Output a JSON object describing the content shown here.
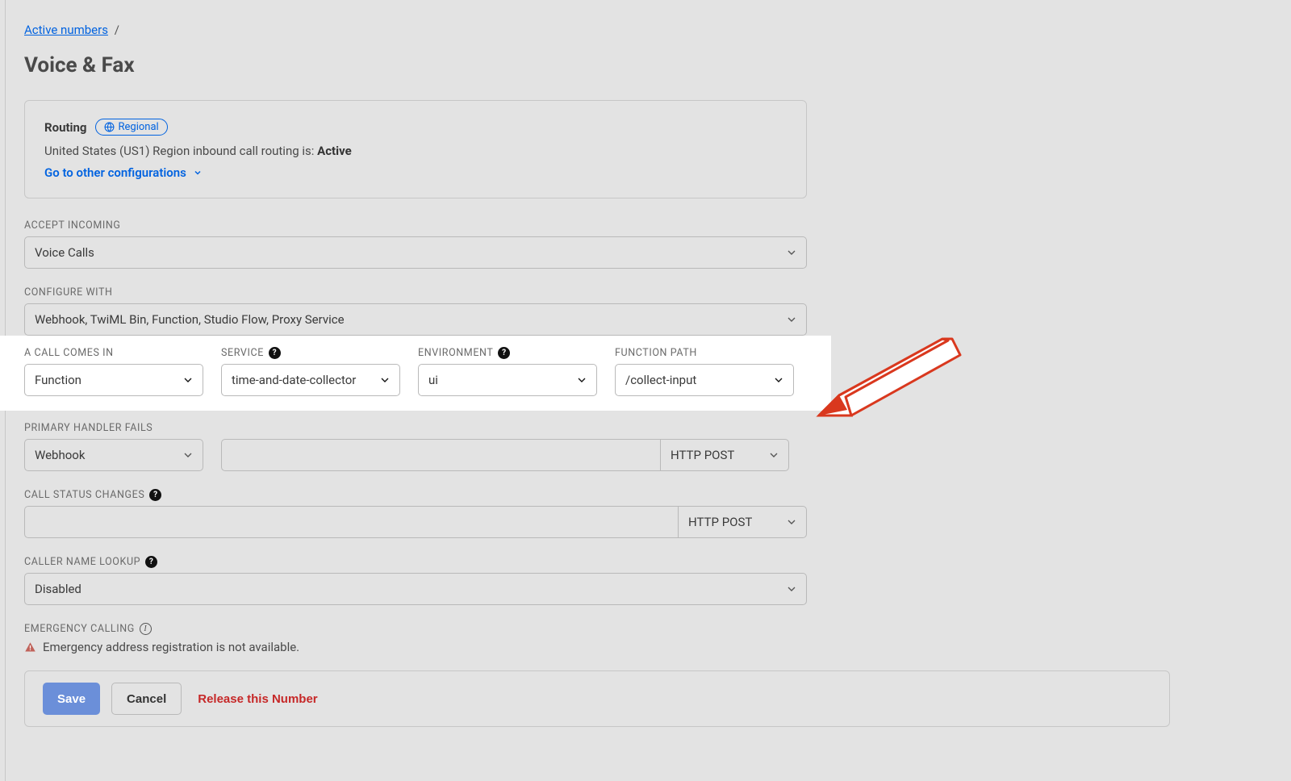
{
  "breadcrumb": {
    "link": "Active numbers",
    "sep": "/"
  },
  "page_title": "Voice & Fax",
  "routing": {
    "label": "Routing",
    "badge": "Regional",
    "status_prefix": "United States (US1) Region inbound call routing is: ",
    "status_value": "Active",
    "link": "Go to other configurations"
  },
  "accept_incoming": {
    "label": "ACCEPT INCOMING",
    "value": "Voice Calls"
  },
  "configure_with": {
    "label": "CONFIGURE WITH",
    "value": "Webhook, TwiML Bin, Function, Studio Flow, Proxy Service"
  },
  "call_comes_in": {
    "label": "A CALL COMES IN",
    "handler": "Function",
    "service_label": "SERVICE",
    "service": "time-and-date-collector",
    "environment_label": "ENVIRONMENT",
    "environment": "ui",
    "function_path_label": "FUNCTION PATH",
    "function_path": "/collect-input"
  },
  "primary_fails": {
    "label": "PRIMARY HANDLER FAILS",
    "handler": "Webhook",
    "method": "HTTP POST"
  },
  "call_status_changes": {
    "label": "CALL STATUS CHANGES",
    "method": "HTTP POST"
  },
  "caller_name_lookup": {
    "label": "CALLER NAME LOOKUP",
    "value": "Disabled"
  },
  "emergency": {
    "label": "EMERGENCY CALLING",
    "msg": "Emergency address registration is not available."
  },
  "footer": {
    "save": "Save",
    "cancel": "Cancel",
    "release": "Release this Number"
  }
}
